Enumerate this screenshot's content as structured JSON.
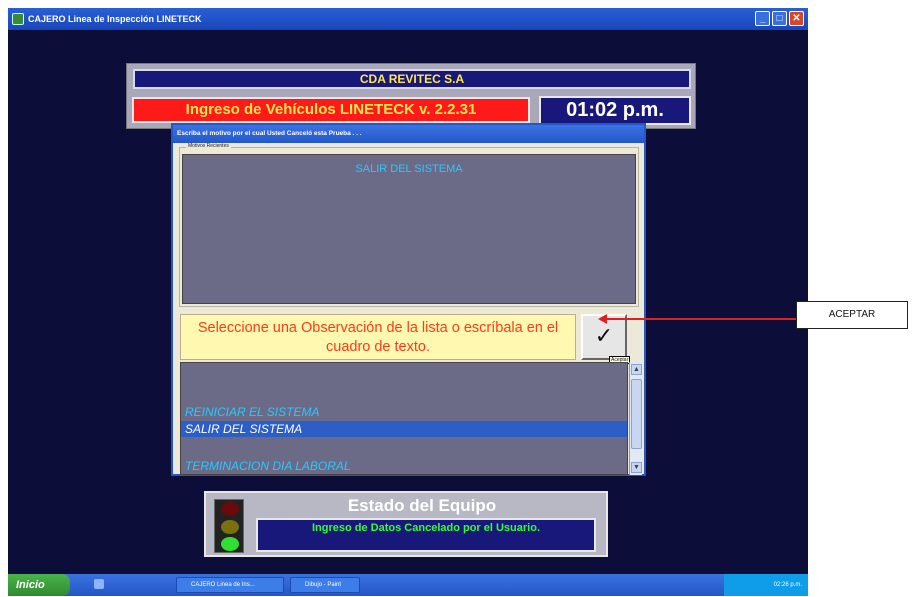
{
  "window": {
    "title": "CAJERO Linea de Inspección LINETECK",
    "controls": [
      "_",
      "□",
      "✕"
    ]
  },
  "header": {
    "company": "CDA REVITEC S.A",
    "app_name": "Ingreso de Vehículos LINETECK v. 2.2.31",
    "time": "01:02 p.m."
  },
  "dialog": {
    "title": "Escriba el motivo por el cual Usted Canceló esta Prueba . . .",
    "group_label": "Motivos Recientes",
    "text_value": "SALIR DEL SISTEMA",
    "instruction": "Seleccione una Observación de la lista o escríbala en el cuadro de texto.",
    "ok_symbol": "✓",
    "ok_tooltip": "Aceptar",
    "list_items": [
      {
        "label": "REINICIAR EL SISTEMA",
        "selected": false
      },
      {
        "label": "SALIR DEL SISTEMA",
        "selected": true
      },
      {
        "label": "TERMINACION DIA LABORAL",
        "selected": false
      }
    ],
    "scroll_up": "▲",
    "scroll_down": "▼"
  },
  "status": {
    "title": "Estado del Equipo",
    "message": "Ingreso de Datos Cancelado por el Usuario.",
    "active_light": "green"
  },
  "taskbar": {
    "start_label": "Inicio",
    "tasks": [
      "CAJERO Linea de Ins...",
      "Dibujo - Paint"
    ],
    "tray_time": "02:26 p.m."
  },
  "callout": {
    "label": "ACEPTAR",
    "color": "#e02020"
  }
}
